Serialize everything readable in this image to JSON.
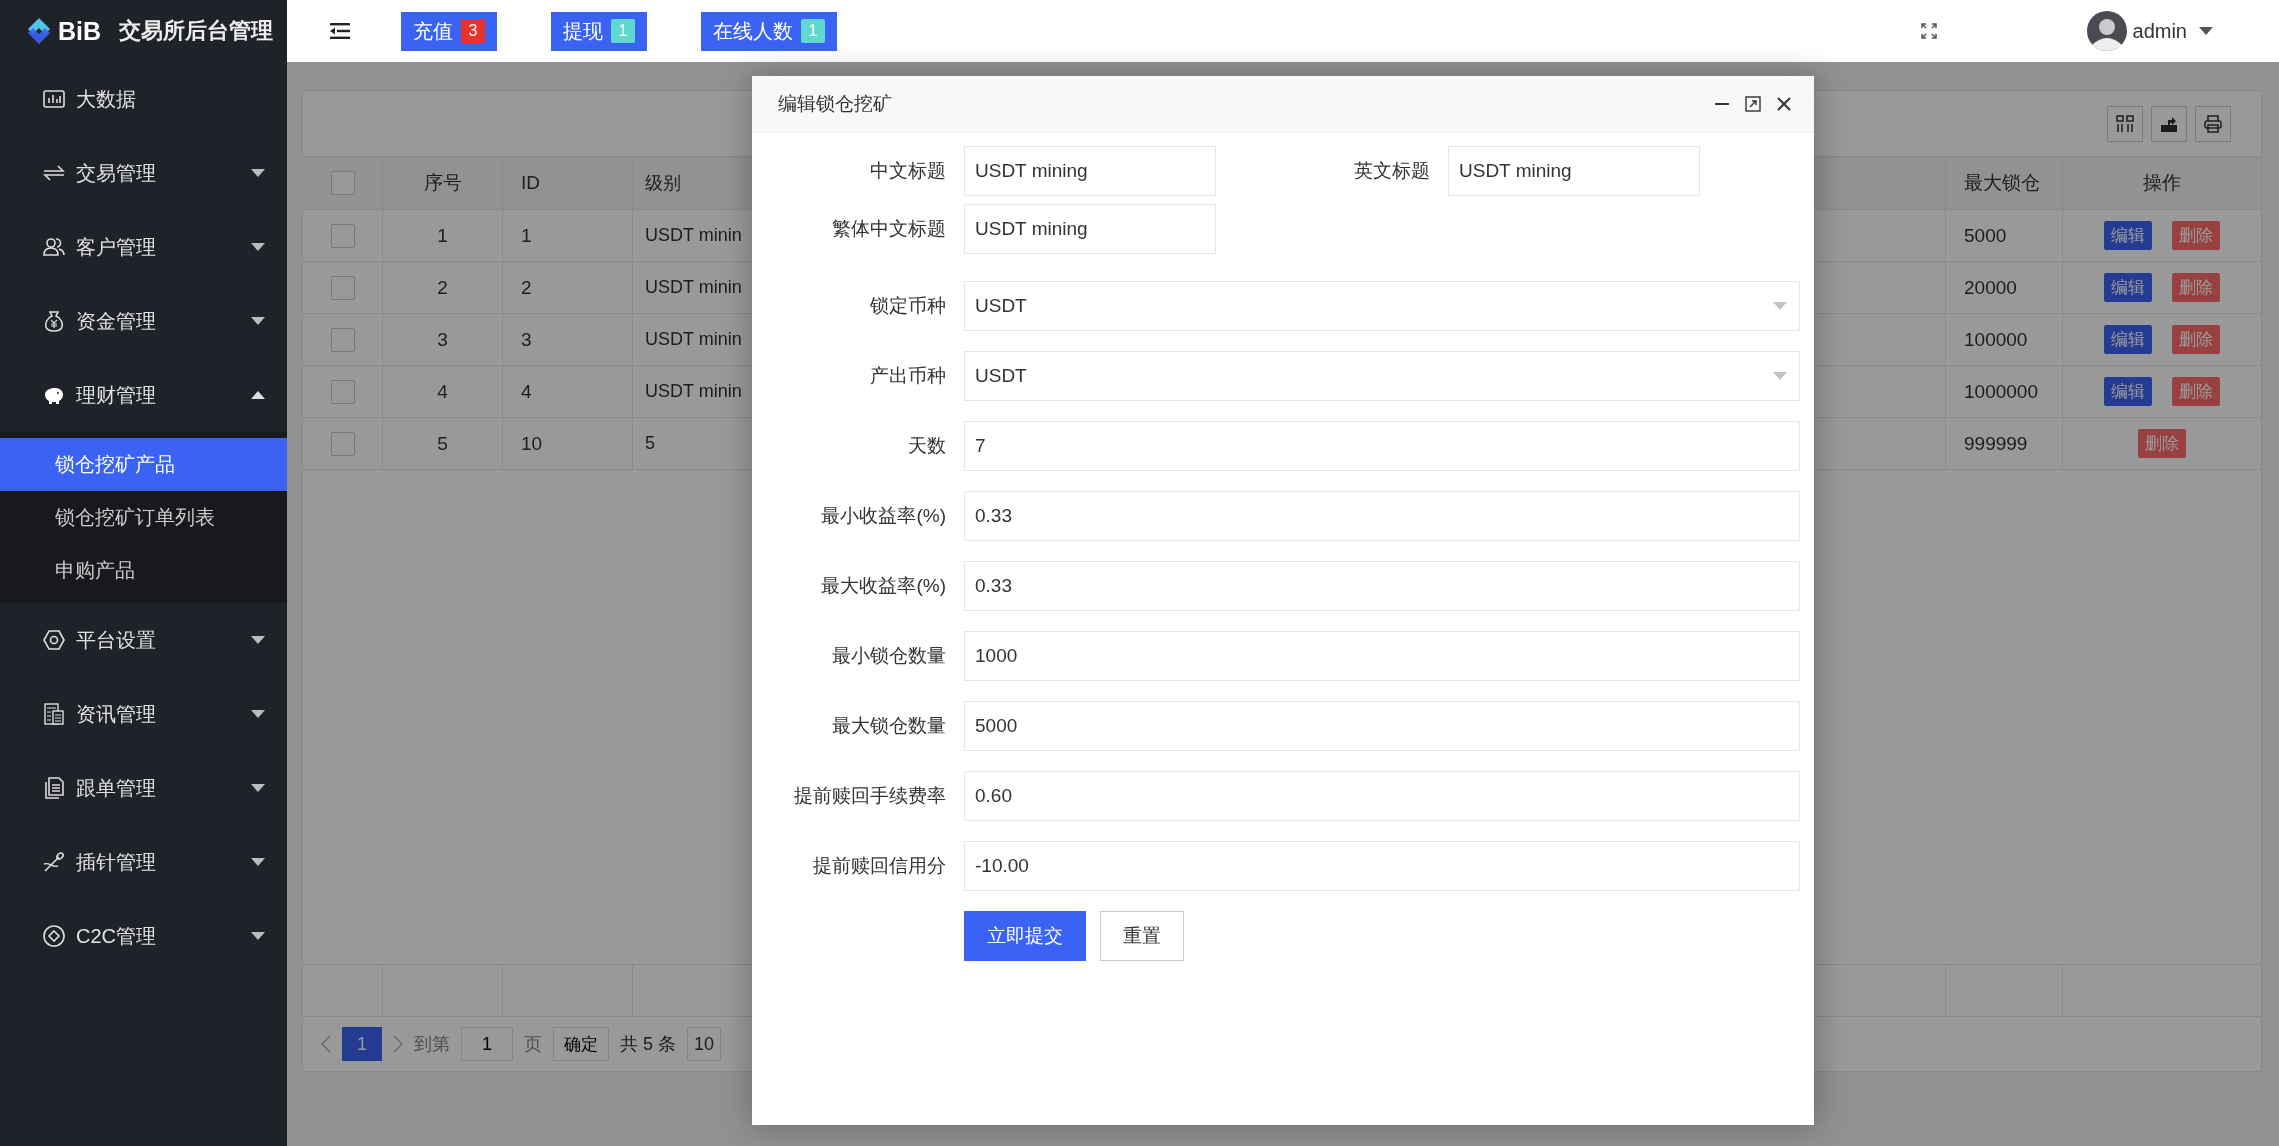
{
  "app": {
    "logo": "BiB",
    "title": "交易所后台管理"
  },
  "sidebar": {
    "items": [
      {
        "label": "大数据",
        "kind": "link"
      },
      {
        "label": "交易管理",
        "kind": "menu",
        "expanded": false
      },
      {
        "label": "客户管理",
        "kind": "menu",
        "expanded": false
      },
      {
        "label": "资金管理",
        "kind": "menu",
        "expanded": false
      },
      {
        "label": "理财管理",
        "kind": "menu",
        "expanded": true,
        "children": [
          {
            "label": "锁仓挖矿产品",
            "selected": true
          },
          {
            "label": "锁仓挖矿订单列表",
            "selected": false
          },
          {
            "label": "申购产品",
            "selected": false
          }
        ]
      },
      {
        "label": "平台设置",
        "kind": "menu",
        "expanded": false
      },
      {
        "label": "资讯管理",
        "kind": "menu",
        "expanded": false
      },
      {
        "label": "跟单管理",
        "kind": "menu",
        "expanded": false
      },
      {
        "label": "插针管理",
        "kind": "menu",
        "expanded": false
      },
      {
        "label": "C2C管理",
        "kind": "menu",
        "expanded": false
      }
    ]
  },
  "top_bar": {
    "shortcuts": [
      {
        "label": "充值",
        "count": "3",
        "color": "#e8332b"
      },
      {
        "label": "提现",
        "count": "1",
        "color": "#5fd9cf"
      },
      {
        "label": "在线人数",
        "count": "1",
        "color": "#5fd9cf"
      }
    ],
    "user": "admin"
  },
  "table": {
    "all_checked": false,
    "columns": [
      "序号",
      "ID",
      "级别",
      "最大锁仓",
      "操作"
    ],
    "rows": [
      {
        "checked": false,
        "cells": [
          "1",
          "1",
          "USDT minin",
          "5000"
        ],
        "actions": [
          {
            "label": "编辑",
            "kind": "edit"
          },
          {
            "label": "删除",
            "kind": "delete"
          }
        ]
      },
      {
        "checked": false,
        "cells": [
          "2",
          "2",
          "USDT minin",
          "20000"
        ],
        "actions": [
          {
            "label": "编辑",
            "kind": "edit"
          },
          {
            "label": "删除",
            "kind": "delete"
          }
        ]
      },
      {
        "checked": false,
        "cells": [
          "3",
          "3",
          "USDT minin",
          "100000"
        ],
        "actions": [
          {
            "label": "编辑",
            "kind": "edit"
          },
          {
            "label": "删除",
            "kind": "delete"
          }
        ]
      },
      {
        "checked": false,
        "cells": [
          "4",
          "4",
          "USDT minin",
          "1000000"
        ],
        "actions": [
          {
            "label": "编辑",
            "kind": "edit"
          },
          {
            "label": "删除",
            "kind": "delete"
          }
        ]
      },
      {
        "checked": false,
        "cells": [
          "5",
          "10",
          "5",
          "999999"
        ],
        "actions": [
          {
            "label": "删除",
            "kind": "delete"
          }
        ]
      }
    ]
  },
  "pagination": {
    "pages": [
      {
        "label": "1",
        "selected": true
      }
    ],
    "goto_label": "到第",
    "goto_value": "1",
    "page_unit": "页",
    "confirm": "确定",
    "total": "共 5 条",
    "page_size": "10"
  },
  "dialog": {
    "title": "编辑锁仓挖矿",
    "fields": [
      {
        "label": "中文标题",
        "value": "USDT mining",
        "kind": "short"
      },
      {
        "label": "英文标题",
        "value": "USDT mining",
        "kind": "short"
      },
      {
        "label": "繁体中文标题",
        "value": "USDT mining",
        "kind": "short"
      },
      {
        "label": "锁定币种",
        "value": "USDT",
        "kind": "select"
      },
      {
        "label": "产出币种",
        "value": "USDT",
        "kind": "select"
      },
      {
        "label": "天数",
        "value": "7",
        "kind": "text"
      },
      {
        "label": "最小收益率(%)",
        "value": "0.33",
        "kind": "text"
      },
      {
        "label": "最大收益率(%)",
        "value": "0.33",
        "kind": "text"
      },
      {
        "label": "最小锁仓数量",
        "value": "1000",
        "kind": "text"
      },
      {
        "label": "最大锁仓数量",
        "value": "5000",
        "kind": "text"
      },
      {
        "label": "提前赎回手续费率",
        "value": "0.60",
        "kind": "text"
      },
      {
        "label": "提前赎回信用分",
        "value": "-10.00",
        "kind": "text"
      }
    ],
    "buttons": [
      {
        "label": "立即提交",
        "kind": "primary"
      },
      {
        "label": "重置",
        "kind": "default"
      }
    ]
  }
}
